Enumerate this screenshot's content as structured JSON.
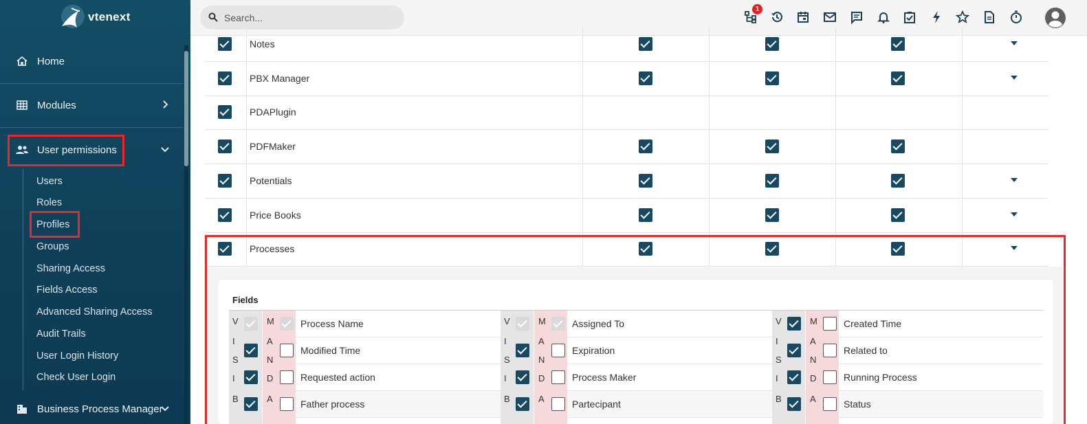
{
  "app": {
    "logo_text": "vtenext"
  },
  "search": {
    "placeholder": "Search..."
  },
  "topbar": {
    "notification_count": "1",
    "icons": [
      "hierarchy-icon",
      "history-icon",
      "calendar-icon",
      "mail-icon",
      "chat-icon",
      "bell-icon",
      "tasks-icon",
      "flash-icon",
      "star-icon",
      "document-icon",
      "timer-icon"
    ]
  },
  "sidebar": {
    "home": "Home",
    "modules": "Modules",
    "user_permissions": "User permissions",
    "sub_items": [
      "Users",
      "Roles",
      "Profiles",
      "Groups",
      "Sharing Access",
      "Fields Access",
      "Advanced Sharing Access",
      "Audit Trails",
      "User Login History",
      "Check User Login"
    ],
    "bpm": "Business Process Manager"
  },
  "modules_table": {
    "rows": [
      {
        "label": "Notes",
        "enabled": true,
        "c1": true,
        "c2": true,
        "c3": true,
        "expand": true
      },
      {
        "label": "PBX Manager",
        "enabled": true,
        "c1": true,
        "c2": true,
        "c3": true,
        "expand": true
      },
      {
        "label": "PDAPlugin",
        "enabled": true,
        "c1": null,
        "c2": null,
        "c3": null,
        "expand": false
      },
      {
        "label": "PDFMaker",
        "enabled": true,
        "c1": true,
        "c2": true,
        "c3": true,
        "expand": false
      },
      {
        "label": "Potentials",
        "enabled": true,
        "c1": true,
        "c2": true,
        "c3": true,
        "expand": true
      },
      {
        "label": "Price Books",
        "enabled": true,
        "c1": true,
        "c2": true,
        "c3": true,
        "expand": true
      },
      {
        "label": "Processes",
        "enabled": true,
        "c1": true,
        "c2": true,
        "c3": true,
        "expand": true
      }
    ]
  },
  "fields": {
    "title": "Fields",
    "visible_letters": [
      "V",
      "I",
      "S",
      "I",
      "B"
    ],
    "mandatory_letters": [
      "M",
      "A",
      "N",
      "D",
      "A"
    ],
    "columns": [
      [
        {
          "label": "Process Name",
          "v": "dis",
          "m": "dis"
        },
        {
          "label": "Modified Time",
          "v": "on",
          "m": "off"
        },
        {
          "label": "Requested action",
          "v": "on",
          "m": "off"
        },
        {
          "label": "Father process",
          "v": "on",
          "m": "off"
        }
      ],
      [
        {
          "label": "Assigned To",
          "v": "dis",
          "m": "dis"
        },
        {
          "label": "Expiration",
          "v": "on",
          "m": "off"
        },
        {
          "label": "Process Maker",
          "v": "on",
          "m": "off"
        },
        {
          "label": "Partecipant",
          "v": "on",
          "m": "off"
        }
      ],
      [
        {
          "label": "Created Time",
          "v": "on",
          "m": "off"
        },
        {
          "label": "Related to",
          "v": "on",
          "m": "off"
        },
        {
          "label": "Running Process",
          "v": "on",
          "m": "off"
        },
        {
          "label": "Status",
          "v": "on",
          "m": "off"
        }
      ]
    ]
  },
  "colors": {
    "sidebar": "#134d66",
    "checkbox": "#174a62",
    "highlight": "#e8282b",
    "mandatory_bg": "#f6d9db"
  }
}
